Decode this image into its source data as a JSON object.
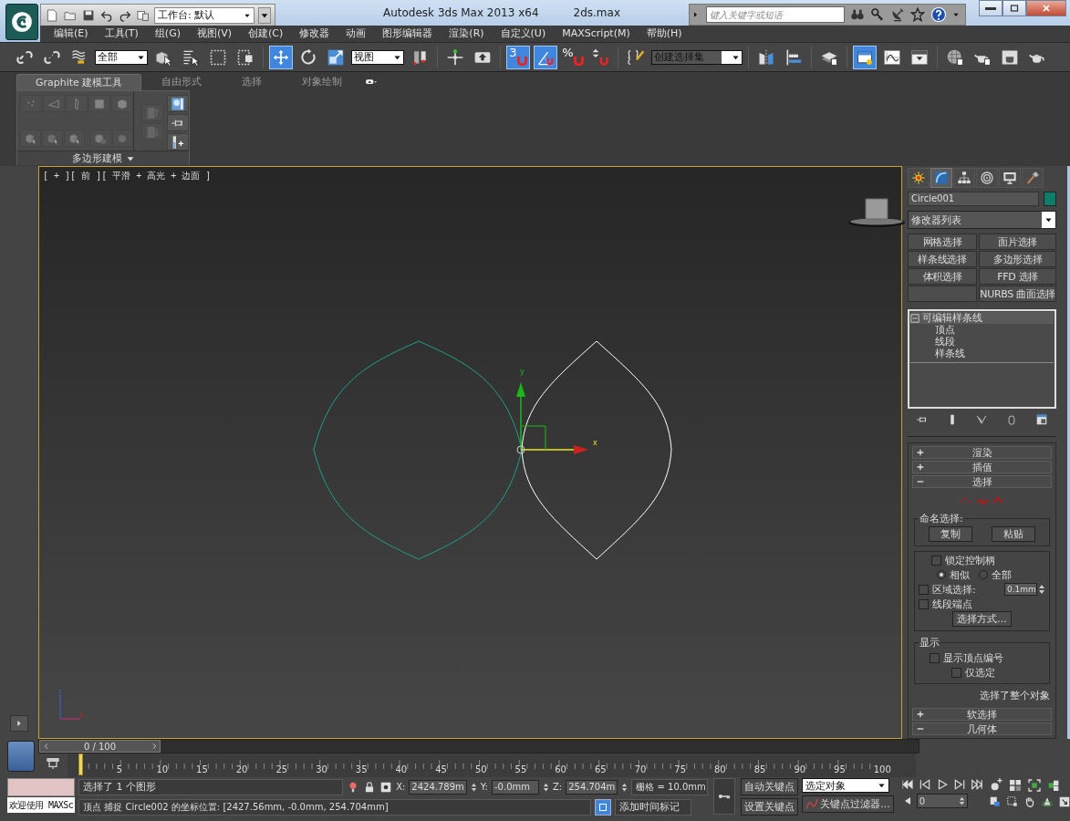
{
  "title_bar": {
    "workspace": "工作台: 默认",
    "app_title": "Autodesk 3ds Max  2013 x64",
    "file_name": "2ds.max",
    "search": {
      "placeholder": "键入关键字或短语"
    }
  },
  "menu": [
    "编辑(E)",
    "工具(T)",
    "组(G)",
    "视图(V)",
    "创建(C)",
    "修改器",
    "动画",
    "图形编辑器",
    "渲染(R)",
    "自定义(U)",
    "MAXScript(M)",
    "帮助(H)"
  ],
  "toolbar": [
    {
      "kind": "link",
      "on": false
    },
    {
      "kind": "unlink",
      "on": false
    },
    {
      "kind": "bind",
      "on": false
    },
    {
      "kind": "dropdown",
      "value": "全部"
    },
    {
      "kind": "select",
      "on": false
    },
    {
      "kind": "select-by-name",
      "on": false
    },
    {
      "kind": "region",
      "on": false
    },
    {
      "kind": "crossing",
      "on": false
    },
    {
      "kind": "separator"
    },
    {
      "kind": "move",
      "on": true
    },
    {
      "kind": "rotate",
      "on": false
    },
    {
      "kind": "scale",
      "on": false
    },
    {
      "kind": "dropdown",
      "value": "视图"
    },
    {
      "kind": "pivot",
      "on": false
    },
    {
      "kind": "separator"
    },
    {
      "kind": "manipulate",
      "on": false
    },
    {
      "kind": "keyboard",
      "on": false
    },
    {
      "kind": "separator"
    },
    {
      "kind": "snap",
      "on": true,
      "label": "3"
    },
    {
      "kind": "angle-snap",
      "on": true
    },
    {
      "kind": "percent-snap",
      "on": false,
      "label": "%"
    },
    {
      "kind": "spinner-snap",
      "on": false
    },
    {
      "kind": "separator"
    },
    {
      "kind": "named-sets",
      "on": false
    },
    {
      "kind": "dropdown",
      "value": "创建选择集"
    },
    {
      "kind": "separator"
    },
    {
      "kind": "mirror",
      "on": false
    },
    {
      "kind": "align",
      "on": false
    },
    {
      "kind": "separator"
    },
    {
      "kind": "layers",
      "on": false
    },
    {
      "kind": "separator"
    },
    {
      "kind": "explorer",
      "on": true
    },
    {
      "kind": "curve-editor",
      "on": false
    },
    {
      "kind": "schematic",
      "on": false
    },
    {
      "kind": "separator"
    },
    {
      "kind": "material",
      "on": false
    },
    {
      "kind": "render-setup",
      "on": false
    },
    {
      "kind": "render-frame",
      "on": false
    },
    {
      "kind": "render",
      "on": false
    }
  ],
  "ribbon": {
    "tabs": [
      {
        "label": "Graphite 建模工具",
        "selected": true
      },
      {
        "label": "自由形式",
        "selected": false
      },
      {
        "label": "选择",
        "selected": false
      },
      {
        "label": "对象绘制",
        "selected": false
      }
    ],
    "panel_label": "多边形建模"
  },
  "viewport": {
    "label": "[ + ][ 前 ][ 平滑 + 高光 + 边面 ]",
    "gizmo": {
      "y_label": "y",
      "x_label": "x"
    },
    "tripod": {
      "z_label": "z",
      "x_label": "x"
    }
  },
  "command_panel": {
    "tabs": [
      {
        "kind": "create",
        "selected": false
      },
      {
        "kind": "modify",
        "selected": true
      },
      {
        "kind": "hierarchy",
        "selected": false
      },
      {
        "kind": "motion",
        "selected": false
      },
      {
        "kind": "display",
        "selected": false
      },
      {
        "kind": "utilities",
        "selected": false
      }
    ],
    "object_name": "Circle001",
    "modifier_list": "修改器列表",
    "modifier_buttons": [
      {
        "kind": "preset",
        "label": "网格选择"
      },
      {
        "kind": "preset",
        "label": "面片选择"
      },
      {
        "kind": "preset",
        "label": "样条线选择"
      },
      {
        "kind": "preset",
        "label": "多边形选择"
      },
      {
        "kind": "preset",
        "label": "体积选择"
      },
      {
        "kind": "preset",
        "label": "FFD 选择"
      },
      {
        "kind": "blank"
      },
      {
        "kind": "preset",
        "label": "NURBS 曲面选择"
      }
    ],
    "stack": [
      {
        "label": "可编辑样条线",
        "expanded": true,
        "selected": true,
        "children": [
          {
            "label": "顶点",
            "selected": false
          },
          {
            "label": "线段",
            "selected": false
          },
          {
            "label": "样条线",
            "selected": false
          }
        ]
      }
    ],
    "rollouts": [
      {
        "label": "渲染",
        "expanded": false
      },
      {
        "label": "插值",
        "expanded": false
      },
      {
        "label": "选择",
        "expanded": true
      },
      {
        "label": "软选择",
        "expanded": false
      },
      {
        "label": "几何体",
        "expanded": true
      }
    ],
    "selection": {
      "named_selection": {
        "title": "命名选择:",
        "buttons": [
          "复制",
          "粘贴"
        ]
      },
      "lock_handles": {
        "label": "锁定控制柄",
        "checked": false
      },
      "handle_mode": [
        {
          "label": "相似",
          "selected": true
        },
        {
          "label": "全部",
          "selected": false
        }
      ],
      "area_selection": {
        "label": "区域选择:",
        "checked": false,
        "value": "0.1mm"
      },
      "segment_end": {
        "label": "线段端点",
        "checked": false
      },
      "select_by": "选择方式...",
      "display": {
        "title": "显示",
        "show_vertex_numbers": {
          "label": "显示顶点编号",
          "checked": false
        },
        "selected_only": {
          "label": "仅选定",
          "checked": false
        }
      },
      "status": "选择了整个对象"
    }
  },
  "timeline": {
    "frame": "0 / 100",
    "level": 0,
    "ticks": [
      "5",
      "10",
      "15",
      "20",
      "25",
      "30",
      "35",
      "40",
      "45",
      "50",
      "55",
      "60",
      "65",
      "70",
      "75",
      "80",
      "85",
      "90",
      "95",
      "100"
    ]
  },
  "status_bar": {
    "welcome": "欢迎使用 MAXSc",
    "selection": "选择了 1 个图形",
    "coords": [
      {
        "label": "X:",
        "value": "2424.789m"
      },
      {
        "label": "Y:",
        "value": "-0.0mm"
      },
      {
        "label": "Z:",
        "value": "254.704m"
      }
    ],
    "grid": "栅格 = 10.0mm",
    "prompt": "顶点 捕捉 Circle002 的坐标位置:  [2427.56mm, -0.0mm, 254.704mm]",
    "add_time_tag": "添加时间标记",
    "auto_key": "自动关键点",
    "set_key": "设置关键点",
    "key_target": "选定对象",
    "key_filters": "关键点过滤器...",
    "current_frame": "0"
  }
}
